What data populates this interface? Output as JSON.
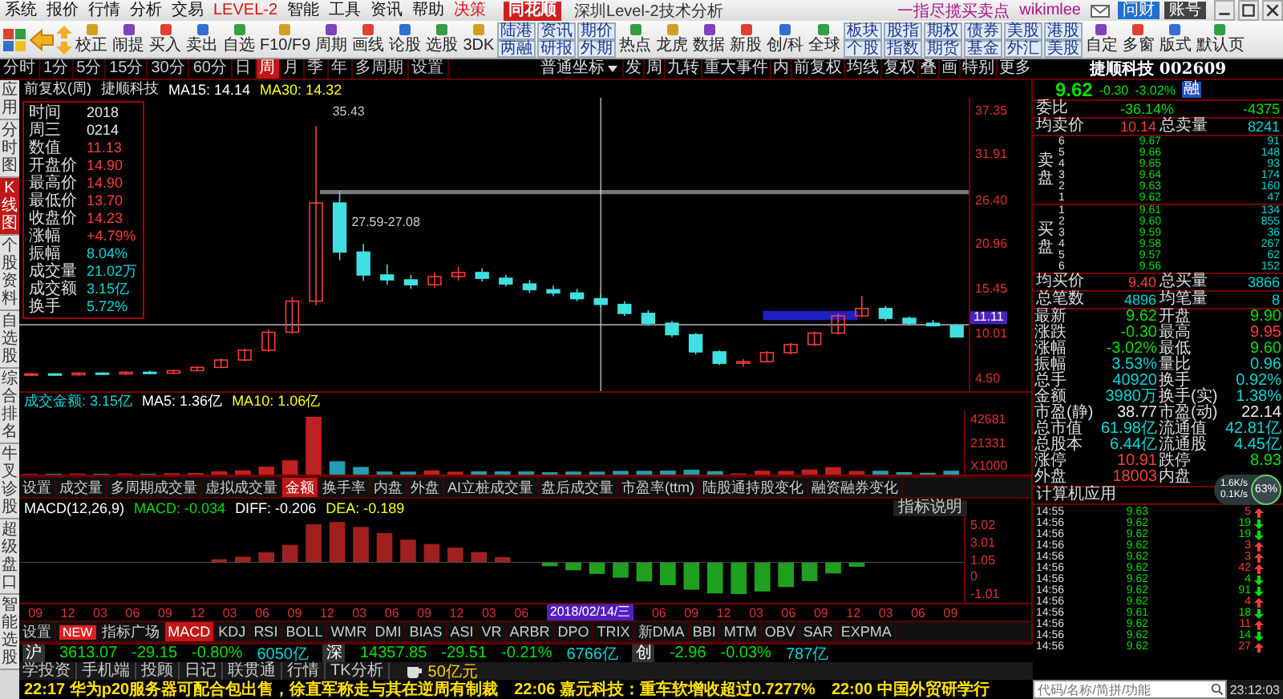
{
  "menu": [
    {
      "label": "系统",
      "highlight": false
    },
    {
      "label": "报价",
      "highlight": false
    },
    {
      "label": "行情",
      "highlight": false
    },
    {
      "label": "分析",
      "highlight": false
    },
    {
      "label": "交易",
      "highlight": false
    },
    {
      "label": "LEVEL-2",
      "highlight": true
    },
    {
      "label": "智能",
      "highlight": false
    },
    {
      "label": "工具",
      "highlight": false
    },
    {
      "label": "资讯",
      "highlight": false
    },
    {
      "label": "帮助",
      "highlight": false
    },
    {
      "label": "决策",
      "highlight": true
    }
  ],
  "logo": "同花顺",
  "title_bar": {
    "title": "深圳Level-2技术分析",
    "slogan": "一指尽揽买卖点",
    "user": "wikimlee",
    "buttons": [
      "问财",
      "账号"
    ]
  },
  "toolbar": [
    {
      "kind": "grid"
    },
    {
      "kind": "back"
    },
    {
      "kind": "updown"
    },
    {
      "kind": "tool",
      "label": "校正"
    },
    {
      "kind": "tool",
      "label": "闹提"
    },
    {
      "kind": "tool",
      "label": "买入"
    },
    {
      "kind": "tool",
      "label": "卖出"
    },
    {
      "kind": "tool",
      "label": "自选"
    },
    {
      "kind": "tool",
      "label": "F10/F9"
    },
    {
      "kind": "tool",
      "label": "周期"
    },
    {
      "kind": "tool",
      "label": "画线"
    },
    {
      "kind": "tool",
      "label": "论股"
    },
    {
      "kind": "tool",
      "label": "选股"
    },
    {
      "kind": "tool",
      "label": "3DK"
    },
    {
      "kind": "pair",
      "labels": [
        "陆港",
        "两融"
      ]
    },
    {
      "kind": "pair",
      "labels": [
        "资讯",
        "研报"
      ]
    },
    {
      "kind": "pair",
      "labels": [
        "期价",
        "外期"
      ]
    },
    {
      "kind": "tool",
      "label": "热点"
    },
    {
      "kind": "tool",
      "label": "龙虎"
    },
    {
      "kind": "tool",
      "label": "数据"
    },
    {
      "kind": "tool",
      "label": "新股"
    },
    {
      "kind": "tool",
      "label": "创/科"
    },
    {
      "kind": "tool",
      "label": "全球"
    },
    {
      "kind": "pair",
      "labels": [
        "板块",
        "个股"
      ]
    },
    {
      "kind": "pair",
      "labels": [
        "股指",
        "指数"
      ]
    },
    {
      "kind": "pair",
      "labels": [
        "期权",
        "期货"
      ]
    },
    {
      "kind": "pair",
      "labels": [
        "债券",
        "基金"
      ]
    },
    {
      "kind": "pair",
      "labels": [
        "美股",
        "外汇"
      ]
    },
    {
      "kind": "pair",
      "labels": [
        "港股",
        "美股"
      ]
    },
    {
      "kind": "tool",
      "label": "自定"
    },
    {
      "kind": "tool",
      "label": "多窗"
    },
    {
      "kind": "tool",
      "label": "版式"
    },
    {
      "kind": "tool",
      "label": "默认页"
    }
  ],
  "period_tabs": [
    {
      "label": "分时",
      "selected": false
    },
    {
      "label": "1分",
      "selected": false
    },
    {
      "label": "5分",
      "selected": false
    },
    {
      "label": "15分",
      "selected": false
    },
    {
      "label": "30分",
      "selected": false
    },
    {
      "label": "60分",
      "selected": false
    },
    {
      "label": "日",
      "selected": false
    },
    {
      "label": "周",
      "selected": true
    },
    {
      "label": "月",
      "selected": false
    },
    {
      "label": "季",
      "selected": false
    },
    {
      "label": "年",
      "selected": false
    },
    {
      "label": "多周期",
      "selected": false
    },
    {
      "label": "设置",
      "selected": false
    }
  ],
  "coord_select": "普通坐标",
  "chart_tools": [
    "发",
    "周",
    "九转",
    "重大事件",
    "内",
    "前复权",
    "均线",
    "复权",
    "叠",
    "画",
    "特别",
    "更多"
  ],
  "stock": {
    "name": "捷顺科技",
    "code": "002609"
  },
  "vertical_tabs": [
    {
      "label": "应用",
      "selected": false
    },
    {
      "label": "分时图",
      "selected": false
    },
    {
      "label": "K线图",
      "selected": true
    },
    {
      "label": "个股资料",
      "selected": false
    },
    {
      "label": "自选股",
      "selected": false
    },
    {
      "label": "综合排名",
      "selected": false
    },
    {
      "label": "牛叉诊股",
      "selected": false
    },
    {
      "label": "超级盘口",
      "selected": false
    },
    {
      "label": "智能选股",
      "selected": false
    }
  ],
  "chart_header": {
    "mode": "前复权(周)",
    "name": "捷顺科技",
    "ma": [
      {
        "label": "MA15: 14.14",
        "color": "#ffffff"
      },
      {
        "label": "MA30: 14.32",
        "color": "#ffff00"
      }
    ]
  },
  "chart_data": {
    "type": "candlestick",
    "ylim": [
      2.99,
      38.86
    ],
    "yticks": [
      {
        "value": 37.35,
        "label": "37.35"
      },
      {
        "value": 31.91,
        "label": "31.91"
      },
      {
        "value": 26.4,
        "label": "26.40"
      },
      {
        "value": 20.96,
        "label": "20.96"
      },
      {
        "value": 15.45,
        "label": "15.45"
      },
      {
        "value": 10.01,
        "label": "10.01"
      },
      {
        "value": 4.5,
        "label": "4.50"
      }
    ],
    "ohlc": [
      [
        5.0,
        5.2,
        4.9,
        5.1
      ],
      [
        5.1,
        5.2,
        4.9,
        5.0
      ],
      [
        5.0,
        5.3,
        4.9,
        5.2
      ],
      [
        5.2,
        5.3,
        5.0,
        5.1
      ],
      [
        5.1,
        5.4,
        5.0,
        5.3
      ],
      [
        5.3,
        5.5,
        5.1,
        5.2
      ],
      [
        5.2,
        5.6,
        5.1,
        5.5
      ],
      [
        5.5,
        6.0,
        5.4,
        5.9
      ],
      [
        5.9,
        7.0,
        5.8,
        6.8
      ],
      [
        6.8,
        8.2,
        6.6,
        8.0
      ],
      [
        8.0,
        10.5,
        7.8,
        10.2
      ],
      [
        10.2,
        14.5,
        10.0,
        14.0
      ],
      [
        14.0,
        35.43,
        13.5,
        26.0
      ],
      [
        26.0,
        27.5,
        19.0,
        20.0
      ],
      [
        20.0,
        21.0,
        16.5,
        17.2
      ],
      [
        17.2,
        18.5,
        16.0,
        16.6
      ],
      [
        16.6,
        17.2,
        15.5,
        16.0
      ],
      [
        16.0,
        17.5,
        15.6,
        17.0
      ],
      [
        17.0,
        18.2,
        16.5,
        17.5
      ],
      [
        17.5,
        18.0,
        16.4,
        16.8
      ],
      [
        16.8,
        17.2,
        15.8,
        16.1
      ],
      [
        16.1,
        16.6,
        15.0,
        15.4
      ],
      [
        15.4,
        15.9,
        14.6,
        15.0
      ],
      [
        15.0,
        15.5,
        14.0,
        14.3
      ],
      [
        14.3,
        14.9,
        13.2,
        13.6
      ],
      [
        13.6,
        14.0,
        12.2,
        12.5
      ],
      [
        12.5,
        12.9,
        11.0,
        11.3
      ],
      [
        11.3,
        11.6,
        9.6,
        9.9
      ],
      [
        9.9,
        10.1,
        7.5,
        7.8
      ],
      [
        7.8,
        8.0,
        6.2,
        6.4
      ],
      [
        6.4,
        6.9,
        6.0,
        6.6
      ],
      [
        6.6,
        7.9,
        6.5,
        7.7
      ],
      [
        7.7,
        8.9,
        7.5,
        8.7
      ],
      [
        8.7,
        10.3,
        8.5,
        10.1
      ],
      [
        10.1,
        12.5,
        9.9,
        12.2
      ],
      [
        12.2,
        14.6,
        12.0,
        13.1
      ],
      [
        13.1,
        13.4,
        11.6,
        11.9
      ],
      [
        11.9,
        12.1,
        11.0,
        11.3
      ],
      [
        11.3,
        11.7,
        10.9,
        11.0
      ],
      [
        11.0,
        11.2,
        9.6,
        9.62
      ]
    ]
  },
  "price_tag": "11.11",
  "annotations": {
    "peak": "35.43",
    "range": "27.59-27.08"
  },
  "info_panel": [
    {
      "label": "时间",
      "value": "2018",
      "color": "#e8e8e8"
    },
    {
      "label": "周三",
      "value": "0214",
      "color": "#e8e8e8"
    },
    {
      "label": "数值",
      "value": "11.13",
      "color": "#ff3c3c"
    },
    {
      "label": "开盘价",
      "value": "14.90",
      "color": "#ff3c3c"
    },
    {
      "label": "最高价",
      "value": "14.90",
      "color": "#ff3c3c"
    },
    {
      "label": "最低价",
      "value": "13.70",
      "color": "#ff3c3c"
    },
    {
      "label": "收盘价",
      "value": "14.23",
      "color": "#ff3c3c"
    },
    {
      "label": "涨幅",
      "value": "+4.79%",
      "color": "#ff3c3c"
    },
    {
      "label": "振幅",
      "value": "8.04%",
      "color": "#00d8d8"
    },
    {
      "label": "成交量",
      "value": "21.02万",
      "color": "#00d8d8"
    },
    {
      "label": "成交额",
      "value": "3.15亿",
      "color": "#00d8d8"
    },
    {
      "label": "换手",
      "value": "5.72%",
      "color": "#00d8d8"
    }
  ],
  "volume": {
    "header": [
      {
        "label": "成交金额: 3.15亿",
        "color": "#00d8d8"
      },
      {
        "label": "MA5: 1.36亿",
        "color": "#ffffff"
      },
      {
        "label": "MA10: 1.06亿",
        "color": "#ffff00"
      }
    ],
    "axis": [
      "42681",
      "21331",
      "X1000"
    ]
  },
  "volume_tabs": [
    {
      "label": "设置",
      "selected": false
    },
    {
      "label": "成交量",
      "selected": false
    },
    {
      "label": "多周期成交量",
      "selected": false
    },
    {
      "label": "虚拟成交量",
      "selected": false
    },
    {
      "label": "金额",
      "selected": true
    },
    {
      "label": "换手率",
      "selected": false
    },
    {
      "label": "内盘",
      "selected": false
    },
    {
      "label": "外盘",
      "selected": false
    },
    {
      "label": "AI立桩成交量",
      "selected": false
    },
    {
      "label": "盘后成交量",
      "selected": false
    },
    {
      "label": "市盈率(ttm)",
      "selected": false
    },
    {
      "label": "陆股通持股变化",
      "selected": false
    },
    {
      "label": "融资融券变化",
      "selected": false
    }
  ],
  "macd": {
    "header": [
      {
        "label": "MACD(12,26,9)",
        "color": "#ffffff"
      },
      {
        "label": "MACD: -0.034",
        "color": "#00e000"
      },
      {
        "label": "DIFF: -0.206",
        "color": "#ffffff"
      },
      {
        "label": "DEA: -0.189",
        "color": "#ffff00"
      }
    ],
    "help": "指标说明",
    "axis": [
      "5.02",
      "3.01",
      "1.05",
      "0",
      "-1.01"
    ]
  },
  "date_axis": [
    {
      "label": "09",
      "kind": "tick"
    },
    {
      "label": "12",
      "kind": "tick"
    },
    {
      "label": "03",
      "kind": "tick"
    },
    {
      "label": "06",
      "kind": "tick"
    },
    {
      "label": "09",
      "kind": "tick"
    },
    {
      "label": "12",
      "kind": "tick"
    },
    {
      "label": "03",
      "kind": "tick"
    },
    {
      "label": "06",
      "kind": "tick"
    },
    {
      "label": "09",
      "kind": "tick"
    },
    {
      "label": "12",
      "kind": "tick"
    },
    {
      "label": "03",
      "kind": "tick"
    },
    {
      "label": "06",
      "kind": "tick"
    },
    {
      "label": "09",
      "kind": "tick"
    },
    {
      "label": "12",
      "kind": "tick"
    },
    {
      "label": "03",
      "kind": "tick"
    },
    {
      "label": "06",
      "kind": "tick"
    },
    {
      "label": "2018/02/14/三",
      "kind": "crosshair"
    },
    {
      "label": "06",
      "kind": "tick"
    },
    {
      "label": "09",
      "kind": "tick"
    },
    {
      "label": "12",
      "kind": "tick"
    },
    {
      "label": "03",
      "kind": "tick"
    },
    {
      "label": "06",
      "kind": "tick"
    },
    {
      "label": "09",
      "kind": "tick"
    },
    {
      "label": "12",
      "kind": "tick"
    },
    {
      "label": "03",
      "kind": "tick"
    },
    {
      "label": "06",
      "kind": "tick"
    },
    {
      "label": "09",
      "kind": "tick"
    }
  ],
  "indicator_tabs": [
    {
      "label": "设置",
      "selected": false
    },
    {
      "label": "指标广场",
      "selected": false
    },
    {
      "label": "MACD",
      "selected": true
    },
    {
      "label": "KDJ",
      "selected": false
    },
    {
      "label": "RSI",
      "selected": false
    },
    {
      "label": "BOLL",
      "selected": false
    },
    {
      "label": "WMR",
      "selected": false
    },
    {
      "label": "DMI",
      "selected": false
    },
    {
      "label": "BIAS",
      "selected": false
    },
    {
      "label": "ASI",
      "selected": false
    },
    {
      "label": "VR",
      "selected": false
    },
    {
      "label": "ARBR",
      "selected": false
    },
    {
      "label": "DPO",
      "selected": false
    },
    {
      "label": "TRIX",
      "selected": false
    },
    {
      "label": "新DMA",
      "selected": false
    },
    {
      "label": "BBI",
      "selected": false
    },
    {
      "label": "MTM",
      "selected": false
    },
    {
      "label": "OBV",
      "selected": false
    },
    {
      "label": "SAR",
      "selected": false
    },
    {
      "label": "EXPMA",
      "selected": false
    }
  ],
  "new_badge": "NEW",
  "index_bar": [
    {
      "market": "沪",
      "values": [
        {
          "text": "3613.07",
          "color": "#00e000"
        },
        {
          "text": "-29.15",
          "color": "#00e000"
        },
        {
          "text": "-0.80%",
          "color": "#00e000"
        },
        {
          "text": "6050亿",
          "color": "#00d8d8"
        }
      ]
    },
    {
      "market": "深",
      "values": [
        {
          "text": "14357.85",
          "color": "#00e000"
        },
        {
          "text": "-29.51",
          "color": "#00e000"
        },
        {
          "text": "-0.21%",
          "color": "#00e000"
        },
        {
          "text": "6766亿",
          "color": "#00d8d8"
        }
      ]
    },
    {
      "market": "创",
      "values": [
        {
          "text": "-2.96",
          "color": "#00e000"
        },
        {
          "text": "-0.03%",
          "color": "#00e000"
        },
        {
          "text": "787亿",
          "color": "#00d8d8"
        }
      ]
    }
  ],
  "links": [
    "学投资",
    "手机端",
    "投顾",
    "日记",
    "联贯通",
    "行情",
    "TK分析"
  ],
  "funds": "50亿元",
  "news": [
    "22:17 华为p20服务器可配合包出售，徐直军称走与其在逆周有制裁",
    "22:06 嘉元科技：重车软增收超过0.7277%",
    "22:00 中国外贸研学行"
  ],
  "quote": {
    "price": "9.62",
    "change": "-0.30",
    "percent": "-3.02%",
    "badge": "融"
  },
  "bid_ratio": {
    "label": "委比",
    "value": "-36.14%",
    "diff": "-4375"
  },
  "ask_avg": {
    "label": "均卖价",
    "value": "10.14",
    "label2": "总卖量",
    "value2": "8241"
  },
  "sell_label": "卖盘",
  "sells": [
    {
      "level": "6",
      "price": "9.67",
      "volume": "91"
    },
    {
      "level": "5",
      "price": "9.66",
      "volume": "148"
    },
    {
      "level": "4",
      "price": "9.65",
      "volume": "93"
    },
    {
      "level": "3",
      "price": "9.64",
      "volume": "174"
    },
    {
      "level": "2",
      "price": "9.63",
      "volume": "160"
    },
    {
      "level": "1",
      "price": "9.62",
      "volume": "47"
    }
  ],
  "buy_label": "买盘",
  "buys": [
    {
      "level": "1",
      "price": "9.61",
      "volume": "134"
    },
    {
      "level": "2",
      "price": "9.60",
      "volume": "855"
    },
    {
      "level": "3",
      "price": "9.59",
      "volume": "36"
    },
    {
      "level": "4",
      "price": "9.58",
      "volume": "267"
    },
    {
      "level": "5",
      "price": "9.57",
      "volume": "62"
    },
    {
      "level": "6",
      "price": "9.56",
      "volume": "152"
    }
  ],
  "bid_avg": {
    "label": "均买价",
    "value": "9.40",
    "label2": "总买量",
    "value2": "3866"
  },
  "trades_row": {
    "label": "总笔数",
    "value": "4896",
    "label2": "均笔量",
    "value2": "8"
  },
  "stats": [
    {
      "label": "最新",
      "value": "9.62",
      "color": "#00e000"
    },
    {
      "label": "开盘",
      "value": "9.90",
      "color": "#00e000"
    },
    {
      "label": "涨跌",
      "value": "-0.30",
      "color": "#00e000"
    },
    {
      "label": "最高",
      "value": "9.95",
      "color": "#ff3c3c"
    },
    {
      "label": "涨幅",
      "value": "-3.02%",
      "color": "#00e000"
    },
    {
      "label": "最低",
      "value": "9.60",
      "color": "#00e000"
    },
    {
      "label": "振幅",
      "value": "3.53%",
      "color": "#00d8d8"
    },
    {
      "label": "量比",
      "value": "0.96",
      "color": "#00d8d8"
    },
    {
      "label": "总手",
      "value": "40920",
      "color": "#00d8d8"
    },
    {
      "label": "换手",
      "value": "0.92%",
      "color": "#00d8d8"
    },
    {
      "label": "金额",
      "value": "3980万",
      "color": "#00d8d8"
    },
    {
      "label": "换手(实)",
      "value": "1.38%",
      "color": "#00d8d8"
    },
    {
      "label": "市盈(静)",
      "value": "38.77",
      "color": "#e8e8e8"
    },
    {
      "label": "市盈(动)",
      "value": "22.14",
      "color": "#e8e8e8"
    },
    {
      "label": "总市值",
      "value": "61.98亿",
      "color": "#00d8d8"
    },
    {
      "label": "流通值",
      "value": "42.81亿",
      "color": "#00d8d8"
    },
    {
      "label": "总股本",
      "value": "6.44亿",
      "color": "#00d8d8"
    },
    {
      "label": "流通股",
      "value": "4.45亿",
      "color": "#00d8d8"
    },
    {
      "label": "涨停",
      "value": "10.91",
      "color": "#ff3c3c"
    },
    {
      "label": "跌停",
      "value": "8.93",
      "color": "#00e000"
    },
    {
      "label": "外盘",
      "value": "18003",
      "color": "#ff3c3c"
    },
    {
      "label": "内盘"
    }
  ],
  "industry": "计算机应用",
  "speed_widget": {
    "up": "1.6K/s",
    "down": "0.1K/s",
    "percent": "63%"
  },
  "ticks": [
    {
      "time": "14:55",
      "price": "9.63",
      "volume": "5",
      "kind": "buy"
    },
    {
      "time": "14:56",
      "price": "9.62",
      "volume": "19",
      "kind": "sell"
    },
    {
      "time": "14:56",
      "price": "9.62",
      "volume": "19",
      "kind": "sell"
    },
    {
      "time": "14:56",
      "price": "9.62",
      "volume": "3",
      "kind": "buy"
    },
    {
      "time": "14:56",
      "price": "9.62",
      "volume": "3",
      "kind": "buy"
    },
    {
      "time": "14:56",
      "price": "9.62",
      "volume": "42",
      "kind": "buy"
    },
    {
      "time": "14:56",
      "price": "9.62",
      "volume": "4",
      "kind": "sell"
    },
    {
      "time": "14:56",
      "price": "9.62",
      "volume": "91",
      "kind": "sell"
    },
    {
      "time": "14:56",
      "price": "9.62",
      "volume": "4",
      "kind": "buy"
    },
    {
      "time": "14:56",
      "price": "9.61",
      "volume": "18",
      "kind": "sell"
    },
    {
      "time": "14:56",
      "price": "9.62",
      "volume": "11",
      "kind": "buy"
    },
    {
      "time": "14:56",
      "price": "9.62",
      "volume": "14",
      "kind": "sell"
    },
    {
      "time": "14:56",
      "price": "9.62",
      "volume": "27",
      "kind": "buy"
    }
  ],
  "search": {
    "placeholder": "代码/名称/简拼/功能"
  },
  "clock": "23:12:03"
}
